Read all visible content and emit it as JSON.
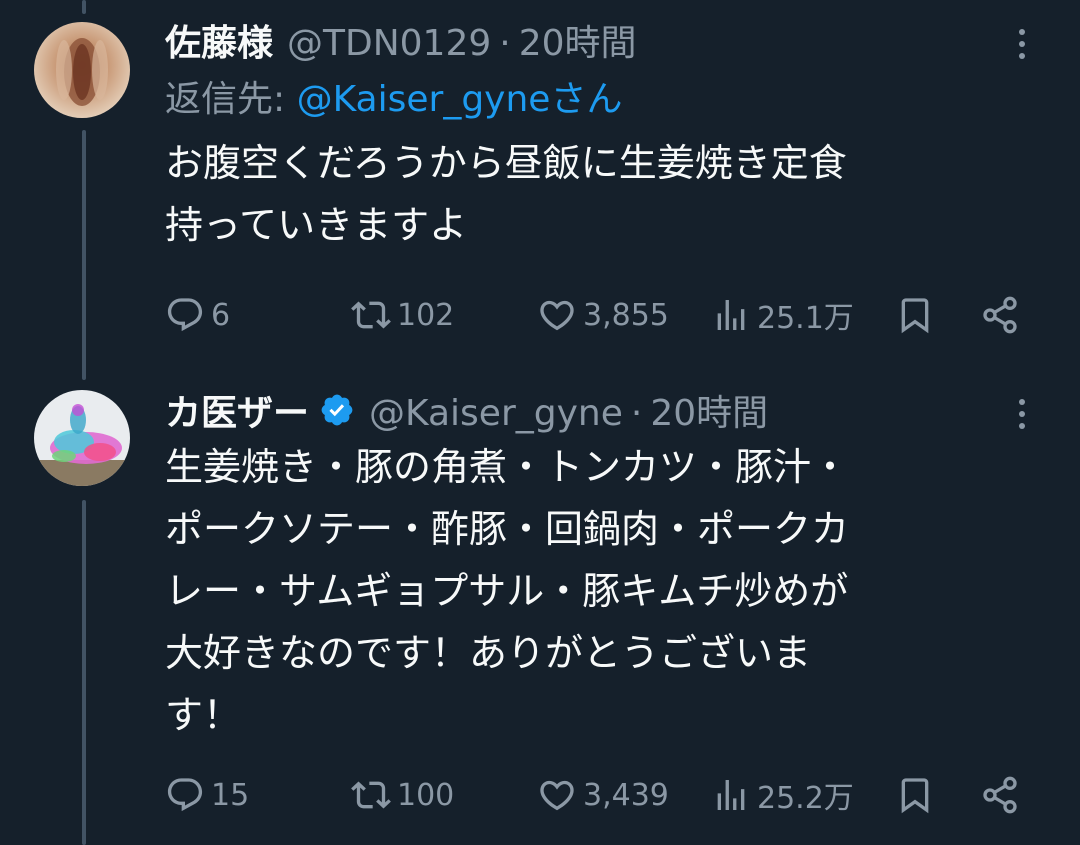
{
  "tweets": [
    {
      "display_name": "佐藤様",
      "handle": "@TDN0129",
      "separator": "·",
      "time": "20時間",
      "reply_prefix": "返信先: ",
      "reply_mention": "@Kaiser_gyne",
      "reply_suffix": "さん",
      "text_line1": "お腹空くだろうから昼飯に生姜焼き定食",
      "text_line2": "持っていきますよ",
      "replies": "6",
      "retweets": "102",
      "likes": "3,855",
      "views": "25.1万"
    },
    {
      "display_name": "カ医ザー",
      "verified": true,
      "handle": "@Kaiser_gyne",
      "separator": "·",
      "time": "20時間",
      "text_line1": "生姜焼き・豚の角煮・トンカツ・豚汁・",
      "text_line2": "ポークソテー・酢豚・回鍋肉・ポークカ",
      "text_line3": "レー・サムギョプサル・豚キムチ炒めが",
      "text_line4": "大好きなのです！ありがとうございま",
      "text_line5": "す！",
      "replies": "15",
      "retweets": "100",
      "likes": "3,439",
      "views": "25.2万"
    }
  ],
  "colors": {
    "background": "#15202b",
    "text": "#f7f9f9",
    "secondary": "#8b98a5",
    "link": "#1d9bf0",
    "verified": "#1d9bf0",
    "thread_line": "#425364"
  },
  "icons": [
    "reply-icon",
    "retweet-icon",
    "like-icon",
    "views-icon",
    "bookmark-icon",
    "share-icon",
    "more-icon",
    "verified-icon"
  ]
}
